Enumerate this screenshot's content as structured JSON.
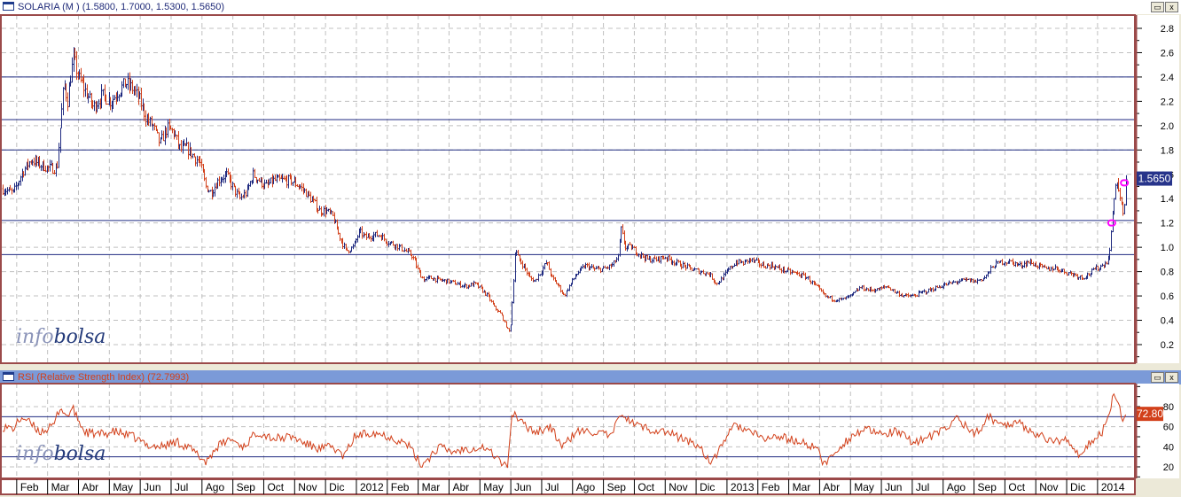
{
  "main_title": "SOLARIA (M ) (1.5800, 1.7000, 1.5300, 1.5650)",
  "rsi_title": "RSI (Relative Strength Index) (72.7993)",
  "window_buttons": {
    "maximize": "▭",
    "close": "x"
  },
  "watermark": {
    "part1": "info",
    "part2": "bolsa"
  },
  "colors": {
    "up": "#1f2a80",
    "down": "#d2401a",
    "level": "#1f2a80",
    "marker": "#ff00ff",
    "border": "#9b4a4a"
  },
  "chart_data": [
    {
      "type": "ohlc",
      "title": "SOLARIA (M )",
      "x_unit": "months since Jan 2011",
      "xlim": [
        0.5,
        37.2
      ],
      "ylim": [
        0.1,
        2.9
      ],
      "y_ticks": [
        "0.2",
        "0.4",
        "0.6",
        "0.8",
        "1.0",
        "1.2",
        "1.4",
        "1.6",
        "1.8",
        "2.0",
        "2.2",
        "2.4",
        "2.6",
        "2.8"
      ],
      "last_value_label": "1.5650",
      "levels": [
        2.4,
        2.05,
        1.8,
        1.22,
        0.94
      ],
      "markers": [
        [
          36.46,
          1.2
        ],
        [
          36.87,
          1.53
        ]
      ],
      "grid": true,
      "close": [
        [
          0.52,
          1.48
        ],
        [
          0.89,
          1.45
        ],
        [
          1.18,
          1.62
        ],
        [
          1.46,
          1.72
        ],
        [
          1.75,
          1.68
        ],
        [
          2.04,
          1.65
        ],
        [
          2.3,
          1.65
        ],
        [
          2.41,
          2.0
        ],
        [
          2.53,
          2.35
        ],
        [
          2.64,
          2.2
        ],
        [
          2.76,
          2.45
        ],
        [
          2.84,
          2.55
        ],
        [
          2.99,
          2.4
        ],
        [
          3.19,
          2.3
        ],
        [
          3.47,
          2.15
        ],
        [
          3.76,
          2.25
        ],
        [
          4.05,
          2.2
        ],
        [
          4.34,
          2.3
        ],
        [
          4.54,
          2.35
        ],
        [
          4.77,
          2.3
        ],
        [
          5.0,
          2.2
        ],
        [
          5.2,
          2.05
        ],
        [
          5.4,
          2.0
        ],
        [
          5.63,
          1.85
        ],
        [
          5.86,
          1.98
        ],
        [
          6.06,
          1.95
        ],
        [
          6.29,
          1.8
        ],
        [
          6.49,
          1.82
        ],
        [
          6.72,
          1.75
        ],
        [
          6.92,
          1.7
        ],
        [
          7.12,
          1.5
        ],
        [
          7.29,
          1.45
        ],
        [
          7.52,
          1.55
        ],
        [
          7.78,
          1.6
        ],
        [
          7.98,
          1.5
        ],
        [
          8.21,
          1.4
        ],
        [
          8.44,
          1.45
        ],
        [
          8.64,
          1.6
        ],
        [
          8.84,
          1.55
        ],
        [
          9.07,
          1.5
        ],
        [
          9.3,
          1.55
        ],
        [
          9.59,
          1.55
        ],
        [
          9.88,
          1.55
        ],
        [
          10.16,
          1.5
        ],
        [
          10.36,
          1.45
        ],
        [
          10.57,
          1.38
        ],
        [
          10.8,
          1.3
        ],
        [
          11.02,
          1.3
        ],
        [
          11.23,
          1.25
        ],
        [
          11.43,
          1.1
        ],
        [
          11.66,
          0.97
        ],
        [
          11.89,
          1.0
        ],
        [
          12.09,
          1.13
        ],
        [
          12.29,
          1.08
        ],
        [
          12.52,
          1.1
        ],
        [
          12.75,
          1.1
        ],
        [
          12.98,
          1.05
        ],
        [
          13.24,
          1.02
        ],
        [
          13.52,
          0.98
        ],
        [
          13.81,
          0.93
        ],
        [
          14.01,
          0.8
        ],
        [
          14.18,
          0.73
        ],
        [
          14.38,
          0.75
        ],
        [
          14.67,
          0.73
        ],
        [
          14.96,
          0.72
        ],
        [
          15.25,
          0.7
        ],
        [
          15.53,
          0.68
        ],
        [
          15.82,
          0.7
        ],
        [
          16.02,
          0.66
        ],
        [
          16.25,
          0.6
        ],
        [
          16.48,
          0.5
        ],
        [
          16.68,
          0.45
        ],
        [
          16.88,
          0.33
        ],
        [
          16.97,
          0.3
        ],
        [
          17.05,
          0.6
        ],
        [
          17.14,
          0.98
        ],
        [
          17.25,
          0.9
        ],
        [
          17.4,
          0.85
        ],
        [
          17.6,
          0.75
        ],
        [
          17.77,
          0.72
        ],
        [
          17.97,
          0.8
        ],
        [
          18.15,
          0.88
        ],
        [
          18.32,
          0.75
        ],
        [
          18.55,
          0.68
        ],
        [
          18.72,
          0.6
        ],
        [
          18.89,
          0.68
        ],
        [
          19.12,
          0.78
        ],
        [
          19.41,
          0.85
        ],
        [
          19.7,
          0.82
        ],
        [
          19.98,
          0.82
        ],
        [
          20.27,
          0.85
        ],
        [
          20.47,
          0.92
        ],
        [
          20.56,
          1.15
        ],
        [
          20.7,
          1.0
        ],
        [
          20.9,
          1.0
        ],
        [
          21.13,
          0.95
        ],
        [
          21.42,
          0.9
        ],
        [
          21.71,
          0.9
        ],
        [
          21.99,
          0.92
        ],
        [
          22.28,
          0.88
        ],
        [
          22.57,
          0.85
        ],
        [
          22.85,
          0.82
        ],
        [
          23.14,
          0.8
        ],
        [
          23.43,
          0.78
        ],
        [
          23.66,
          0.7
        ],
        [
          23.86,
          0.75
        ],
        [
          24.06,
          0.82
        ],
        [
          24.29,
          0.88
        ],
        [
          24.52,
          0.87
        ],
        [
          24.72,
          0.9
        ],
        [
          24.92,
          0.88
        ],
        [
          25.15,
          0.85
        ],
        [
          25.44,
          0.85
        ],
        [
          25.73,
          0.82
        ],
        [
          26.01,
          0.8
        ],
        [
          26.3,
          0.78
        ],
        [
          26.59,
          0.75
        ],
        [
          26.87,
          0.68
        ],
        [
          27.16,
          0.6
        ],
        [
          27.45,
          0.57
        ],
        [
          27.73,
          0.57
        ],
        [
          28.02,
          0.6
        ],
        [
          28.31,
          0.67
        ],
        [
          28.6,
          0.65
        ],
        [
          28.88,
          0.65
        ],
        [
          29.17,
          0.68
        ],
        [
          29.46,
          0.63
        ],
        [
          29.74,
          0.6
        ],
        [
          30.03,
          0.6
        ],
        [
          30.32,
          0.63
        ],
        [
          30.61,
          0.65
        ],
        [
          30.89,
          0.68
        ],
        [
          31.18,
          0.7
        ],
        [
          31.47,
          0.72
        ],
        [
          31.75,
          0.73
        ],
        [
          32.04,
          0.72
        ],
        [
          32.33,
          0.75
        ],
        [
          32.62,
          0.85
        ],
        [
          32.9,
          0.88
        ],
        [
          33.19,
          0.88
        ],
        [
          33.48,
          0.85
        ],
        [
          33.76,
          0.88
        ],
        [
          34.05,
          0.85
        ],
        [
          34.34,
          0.82
        ],
        [
          34.63,
          0.83
        ],
        [
          34.91,
          0.8
        ],
        [
          35.2,
          0.78
        ],
        [
          35.49,
          0.75
        ],
        [
          35.72,
          0.78
        ],
        [
          35.92,
          0.82
        ],
        [
          36.15,
          0.85
        ],
        [
          36.35,
          0.9
        ],
        [
          36.46,
          1.2
        ],
        [
          36.58,
          1.55
        ],
        [
          36.66,
          1.5
        ],
        [
          36.75,
          1.35
        ],
        [
          36.83,
          1.25
        ],
        [
          36.92,
          1.565
        ]
      ]
    },
    {
      "type": "line",
      "title": "RSI (Relative Strength Index)",
      "x_unit": "months since Jan 2011",
      "xlim": [
        0.5,
        37.2
      ],
      "ylim": [
        7,
        103
      ],
      "y_ticks": [
        "20",
        "40",
        "60",
        "80"
      ],
      "levels": [
        70,
        30
      ],
      "last_value_label": "72.80",
      "values": [
        [
          0.52,
          60
        ],
        [
          0.89,
          58
        ],
        [
          1.18,
          70
        ],
        [
          1.75,
          55
        ],
        [
          2.18,
          60
        ],
        [
          2.41,
          80
        ],
        [
          2.61,
          70
        ],
        [
          2.81,
          78
        ],
        [
          3.19,
          55
        ],
        [
          3.62,
          52
        ],
        [
          4.19,
          55
        ],
        [
          4.77,
          50
        ],
        [
          5.2,
          42
        ],
        [
          5.63,
          40
        ],
        [
          6.2,
          45
        ],
        [
          6.63,
          38
        ],
        [
          7.12,
          25
        ],
        [
          7.49,
          40
        ],
        [
          7.92,
          48
        ],
        [
          8.35,
          40
        ],
        [
          8.79,
          55
        ],
        [
          9.36,
          48
        ],
        [
          9.93,
          50
        ],
        [
          10.36,
          43
        ],
        [
          10.8,
          38
        ],
        [
          11.23,
          40
        ],
        [
          11.6,
          30
        ],
        [
          11.94,
          50
        ],
        [
          12.52,
          55
        ],
        [
          13.09,
          50
        ],
        [
          13.67,
          42
        ],
        [
          14.1,
          22
        ],
        [
          14.38,
          30
        ],
        [
          14.67,
          40
        ],
        [
          15.1,
          35
        ],
        [
          15.53,
          38
        ],
        [
          16.11,
          40
        ],
        [
          16.54,
          30
        ],
        [
          16.88,
          18
        ],
        [
          17.05,
          75
        ],
        [
          17.4,
          62
        ],
        [
          17.83,
          55
        ],
        [
          18.26,
          60
        ],
        [
          18.69,
          40
        ],
        [
          19.12,
          55
        ],
        [
          19.7,
          55
        ],
        [
          20.27,
          50
        ],
        [
          20.56,
          75
        ],
        [
          20.84,
          65
        ],
        [
          21.42,
          58
        ],
        [
          21.99,
          55
        ],
        [
          22.57,
          48
        ],
        [
          23.14,
          40
        ],
        [
          23.51,
          22
        ],
        [
          23.86,
          45
        ],
        [
          24.29,
          62
        ],
        [
          24.72,
          55
        ],
        [
          25.15,
          48
        ],
        [
          25.73,
          50
        ],
        [
          26.3,
          45
        ],
        [
          26.87,
          40
        ],
        [
          27.16,
          22
        ],
        [
          27.59,
          38
        ],
        [
          28.02,
          50
        ],
        [
          28.45,
          58
        ],
        [
          28.88,
          52
        ],
        [
          29.46,
          55
        ],
        [
          30.03,
          45
        ],
        [
          30.61,
          50
        ],
        [
          31.18,
          60
        ],
        [
          31.47,
          70
        ],
        [
          31.75,
          60
        ],
        [
          32.04,
          52
        ],
        [
          32.47,
          70
        ],
        [
          32.9,
          62
        ],
        [
          33.33,
          65
        ],
        [
          33.76,
          58
        ],
        [
          34.19,
          50
        ],
        [
          34.63,
          45
        ],
        [
          35.06,
          48
        ],
        [
          35.43,
          28
        ],
        [
          35.77,
          45
        ],
        [
          36.15,
          55
        ],
        [
          36.35,
          70
        ],
        [
          36.52,
          95
        ],
        [
          36.69,
          85
        ],
        [
          36.81,
          65
        ],
        [
          36.92,
          72.8
        ]
      ]
    }
  ],
  "x_axis": {
    "tick_months": [
      1,
      2,
      3,
      4,
      5,
      6,
      7,
      8,
      9,
      10,
      11,
      12,
      13,
      14,
      15,
      16,
      17,
      18,
      19,
      20,
      21,
      22,
      23,
      24,
      25,
      26,
      27,
      28,
      29,
      30,
      31,
      32,
      33,
      34,
      35,
      36
    ],
    "labels": [
      "Feb",
      "Mar",
      "Abr",
      "May",
      "Jun",
      "Jul",
      "Ago",
      "Sep",
      "Oct",
      "Nov",
      "Dic",
      "2012",
      "Feb",
      "Mar",
      "Abr",
      "May",
      "Jun",
      "Jul",
      "Ago",
      "Sep",
      "Oct",
      "Nov",
      "Dic",
      "2013",
      "Feb",
      "Mar",
      "Abr",
      "May",
      "Jun",
      "Jul",
      "Ago",
      "Sep",
      "Oct",
      "Nov",
      "Dic",
      "2014"
    ]
  }
}
